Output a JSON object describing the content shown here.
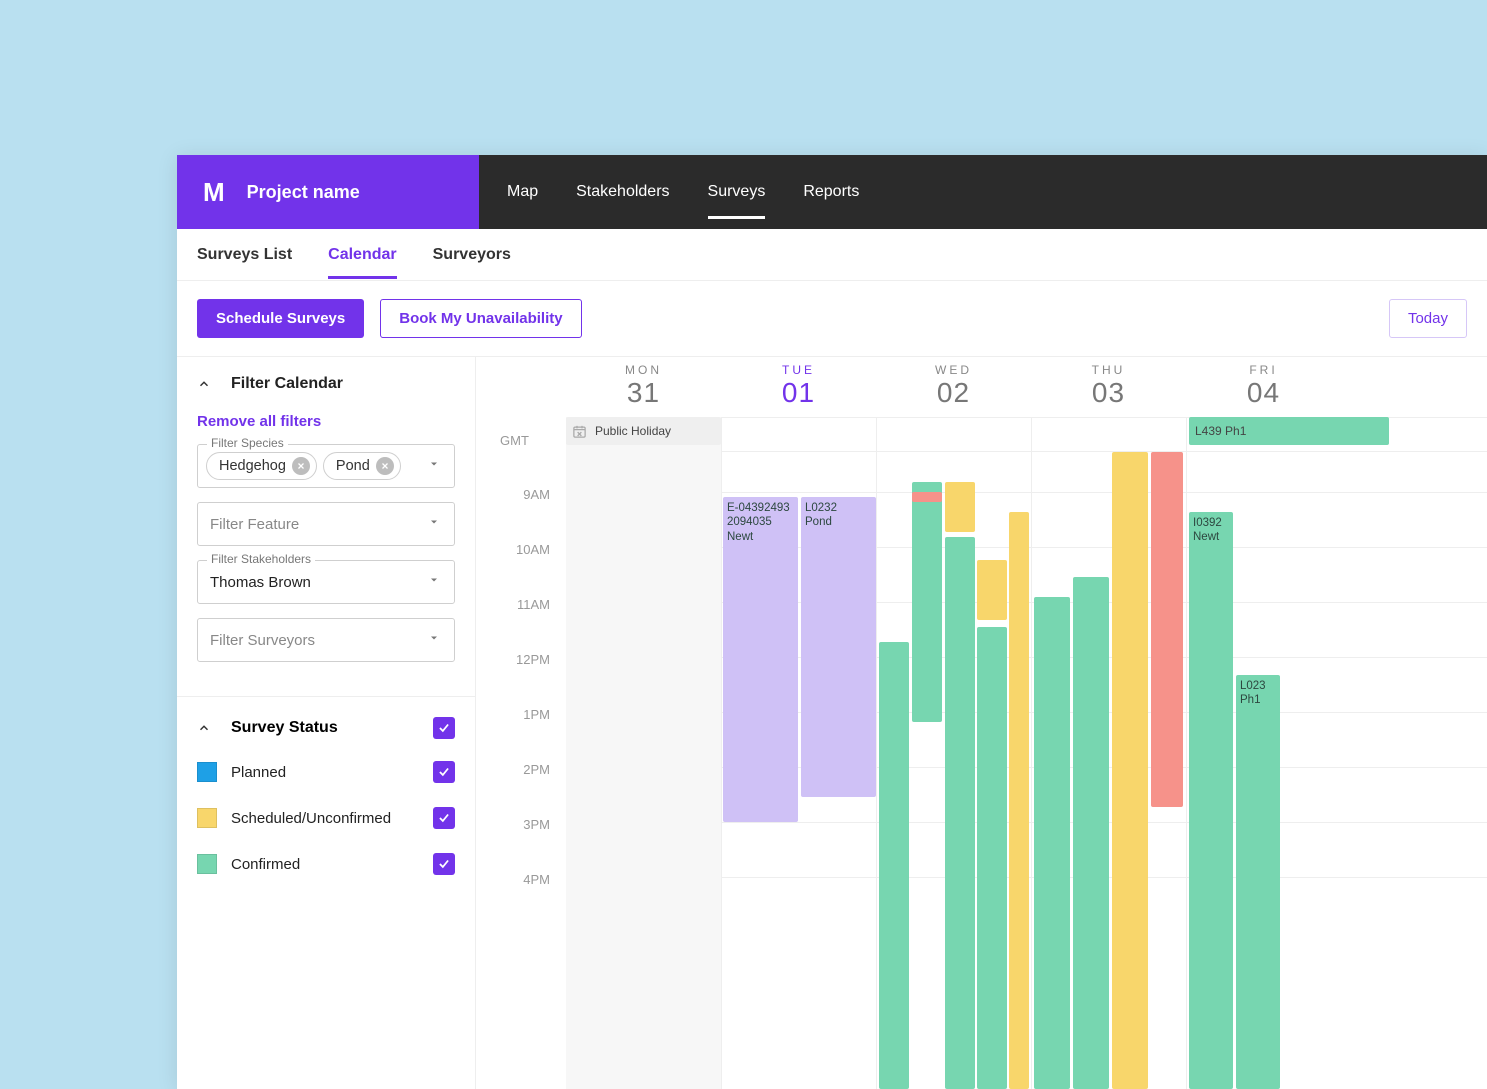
{
  "brand_letter": "M",
  "project_name": "Project name",
  "topnav": [
    "Map",
    "Stakeholders",
    "Surveys",
    "Reports"
  ],
  "topnav_active": "Surveys",
  "subtabs": [
    "Surveys List",
    "Calendar",
    "Surveyors"
  ],
  "subtabs_active": "Calendar",
  "actions": {
    "schedule": "Schedule Surveys",
    "unavailability": "Book My Unavailability",
    "today": "Today"
  },
  "filters": {
    "title": "Filter Calendar",
    "remove_all": "Remove all filters",
    "species_label": "Filter Species",
    "species_chips": [
      "Hedgehog",
      "Pond"
    ],
    "feature_placeholder": "Filter Feature",
    "stakeholders_label": "Filter Stakeholders",
    "stakeholders_value": "Thomas Brown",
    "surveyors_placeholder": "Filter Surveyors"
  },
  "status": {
    "title": "Survey Status",
    "items": [
      {
        "label": "Planned",
        "color": "#1ea0e6"
      },
      {
        "label": "Scheduled/Unconfirmed",
        "color": "#f8d66b"
      },
      {
        "label": "Confirmed",
        "color": "#77d6b0"
      }
    ]
  },
  "calendar": {
    "timezone": "GMT",
    "days": [
      {
        "name": "MON",
        "num": "31",
        "active": false
      },
      {
        "name": "TUE",
        "num": "01",
        "active": true
      },
      {
        "name": "WED",
        "num": "02",
        "active": false
      },
      {
        "name": "THU",
        "num": "03",
        "active": false
      },
      {
        "name": "FRI",
        "num": "04",
        "active": false
      }
    ],
    "time_labels": [
      "9AM",
      "10AM",
      "11AM",
      "12PM",
      "1PM",
      "2PM",
      "3PM",
      "4PM"
    ],
    "holiday": "Public Holiday",
    "events_labeled": {
      "e1_l1": "E-04392493",
      "e1_l2": "2094035",
      "e1_l3": "Newt",
      "e2_l1": "L0232",
      "e2_l2": "Pond",
      "e3_l1": "L439 Ph1",
      "e4_l1": "I0392",
      "e4_l2": "Newt",
      "e5_l1": "L023",
      "e5_l2": "Ph1"
    },
    "colors": {
      "green": "#77d6b0",
      "yellow": "#f8d66b",
      "red": "#f6928a",
      "purple": "#cfc1f6",
      "grey": "#efefef"
    }
  }
}
